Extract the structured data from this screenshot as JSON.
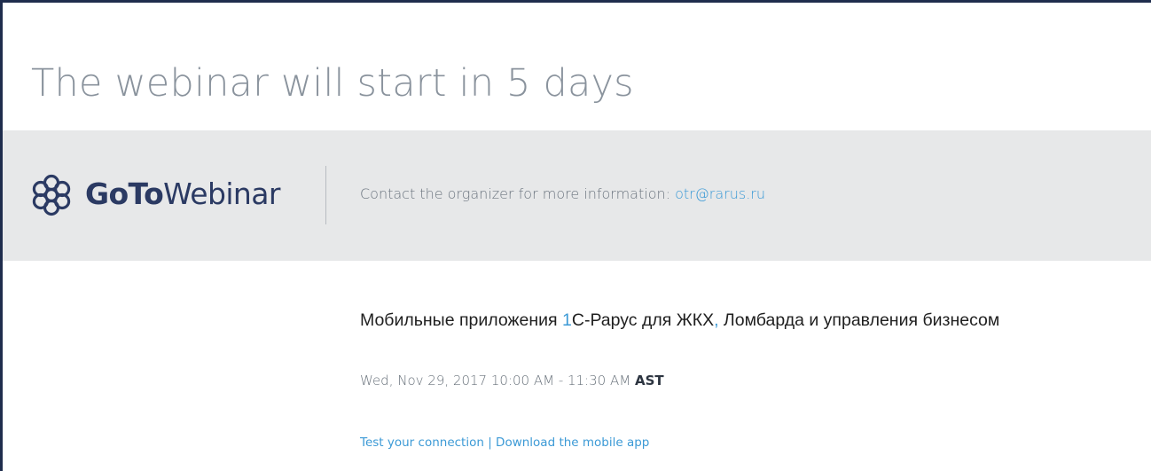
{
  "headline": "The webinar will start in 5 days",
  "brand": {
    "icon": "gotowebinar-flower-icon",
    "name_bold": "GoTo",
    "name_light": "Webinar",
    "color": "#2b3a63"
  },
  "contact": {
    "label": "Contact the organizer for more information: ",
    "email": "otr@rarus.ru"
  },
  "event": {
    "title_part1": "Мобильные приложения ",
    "title_digit": "1",
    "title_part2": "С-Рарус для ЖКХ",
    "title_comma": ",",
    "title_part3": " Ломбарда и управления бизнесом",
    "datetime": "Wed, Nov 29, 2017 10:00 AM - 11:30 AM ",
    "timezone": "AST"
  },
  "links": {
    "test_connection": "Test your connection",
    "separator": " | ",
    "download_app": "Download the mobile app"
  },
  "colors": {
    "link": "#3c9ad6",
    "banner_bg": "#e7e8e9",
    "headline": "#8a939d",
    "frame_border": "#1f2d4d"
  }
}
